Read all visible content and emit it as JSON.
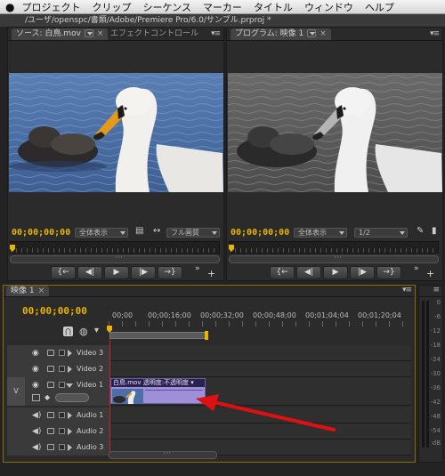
{
  "menu": [
    "プロジェクト",
    "クリップ",
    "シーケンス",
    "マーカー",
    "タイトル",
    "ウィンドウ",
    "ヘルプ"
  ],
  "window_title": "/ユーザ/openspc/書類/Adobe/Premiere Pro/6.0/サンプル.prproj *",
  "source_panel": {
    "tab_source": "ソース: 白鳥.mov",
    "tab_effects": "エフェクトコントロール",
    "timecode": "00;00;00;00",
    "view_dropdown": "全体表示",
    "quality_dropdown": "フル画質"
  },
  "program_panel": {
    "tab": "プログラム: 映像 1",
    "timecode": "00;00;00;00",
    "view_dropdown": "全体表示",
    "resolution_dropdown": "1/2"
  },
  "transport_buttons": [
    "{←",
    "◀|",
    "▶",
    "|▶",
    "→}"
  ],
  "sequence": {
    "tab": "映像 1",
    "timecode": "00;00;00;00",
    "ruler_labels": [
      "00;00",
      "00;00;16;00",
      "00;00;32;00",
      "00;00;48;00",
      "00;01;04;04",
      "00;01;20;04"
    ],
    "tracks": [
      {
        "name": "Video 3",
        "kind": "video"
      },
      {
        "name": "Video 2",
        "kind": "video"
      },
      {
        "name": "Video 1",
        "kind": "video",
        "target": "V"
      },
      {
        "name": "Audio 1",
        "kind": "audio"
      },
      {
        "name": "Audio 2",
        "kind": "audio"
      },
      {
        "name": "Audio 3",
        "kind": "audio"
      }
    ],
    "clip_label": "白鳥.mov  透明度:不透明度 ▾"
  },
  "audio_meter": {
    "ticks": [
      "0",
      "-6",
      "-12",
      "-18",
      "-24",
      "-30",
      "-36",
      "-42",
      "-48",
      "-54"
    ],
    "unit": "dB"
  },
  "colors": {
    "timecode": "#e8b400",
    "clip": "#9f8fd6",
    "arrow": "#dd1111",
    "playhead": "#cc2222"
  }
}
